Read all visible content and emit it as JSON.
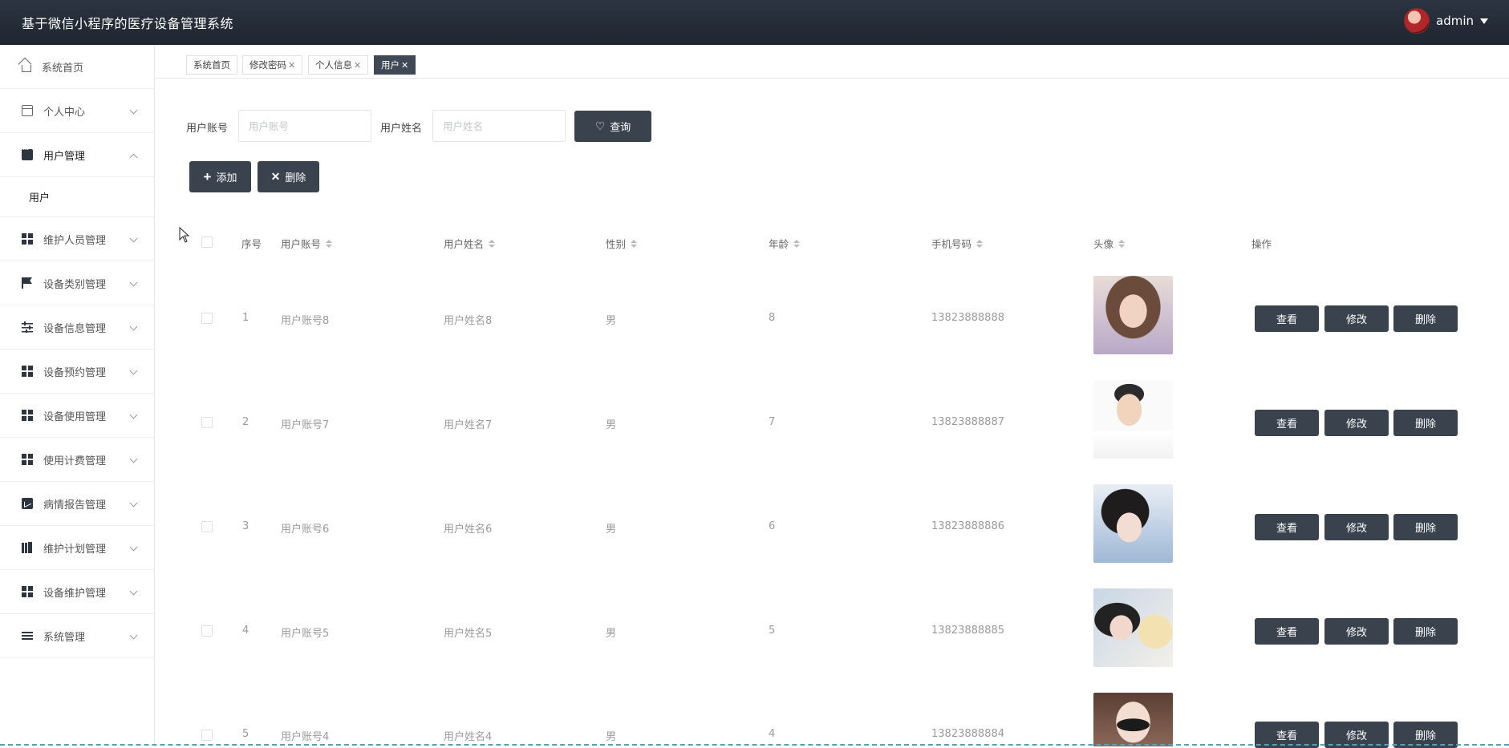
{
  "header": {
    "title": "基于微信小程序的医疗设备管理系统",
    "username": "admin"
  },
  "sidebar": {
    "items": [
      {
        "label": "系统首页",
        "icon": "home-icon"
      },
      {
        "label": "个人中心",
        "icon": "card-icon"
      },
      {
        "label": "用户管理",
        "icon": "chat-icon",
        "expanded": true
      },
      {
        "label": "用户",
        "sub": true
      },
      {
        "label": "维护人员管理",
        "icon": "grid-icon"
      },
      {
        "label": "设备类别管理",
        "icon": "flag-icon"
      },
      {
        "label": "设备信息管理",
        "icon": "sliders-icon"
      },
      {
        "label": "设备预约管理",
        "icon": "grid-icon"
      },
      {
        "label": "设备使用管理",
        "icon": "grid-icon"
      },
      {
        "label": "使用计费管理",
        "icon": "grid-icon"
      },
      {
        "label": "病情报告管理",
        "icon": "chart-icon"
      },
      {
        "label": "维护计划管理",
        "icon": "books-icon"
      },
      {
        "label": "设备维护管理",
        "icon": "grid-icon"
      },
      {
        "label": "系统管理",
        "icon": "lines-icon"
      }
    ]
  },
  "tabs": [
    {
      "label": "系统首页",
      "closable": false
    },
    {
      "label": "修改密码",
      "closable": true
    },
    {
      "label": "个人信息",
      "closable": true
    },
    {
      "label": "用户",
      "closable": true,
      "active": true
    }
  ],
  "search": {
    "account_label": "用户账号",
    "account_placeholder": "用户账号",
    "name_label": "用户姓名",
    "name_placeholder": "用户姓名",
    "query_button": "查询"
  },
  "toolbar": {
    "add_button": "添加",
    "delete_button": "删除"
  },
  "table": {
    "columns": [
      "序号",
      "用户账号",
      "用户姓名",
      "性别",
      "年龄",
      "手机号码",
      "头像",
      "操作"
    ],
    "rows": [
      {
        "index": "1",
        "account": "用户账号8",
        "name": "用户姓名8",
        "gender": "男",
        "age": "8",
        "phone": "13823888888"
      },
      {
        "index": "2",
        "account": "用户账号7",
        "name": "用户姓名7",
        "gender": "男",
        "age": "7",
        "phone": "13823888887"
      },
      {
        "index": "3",
        "account": "用户账号6",
        "name": "用户姓名6",
        "gender": "男",
        "age": "6",
        "phone": "13823888886"
      },
      {
        "index": "4",
        "account": "用户账号5",
        "name": "用户姓名5",
        "gender": "男",
        "age": "5",
        "phone": "13823888885"
      },
      {
        "index": "5",
        "account": "用户账号4",
        "name": "用户姓名4",
        "gender": "男",
        "age": "4",
        "phone": "13823888884"
      }
    ],
    "actions": {
      "view": "查看",
      "edit": "修改",
      "delete": "删除"
    }
  },
  "colors": {
    "topbar": "#1f2630",
    "button": "#3a424e",
    "active_tab": "#3f4854"
  }
}
